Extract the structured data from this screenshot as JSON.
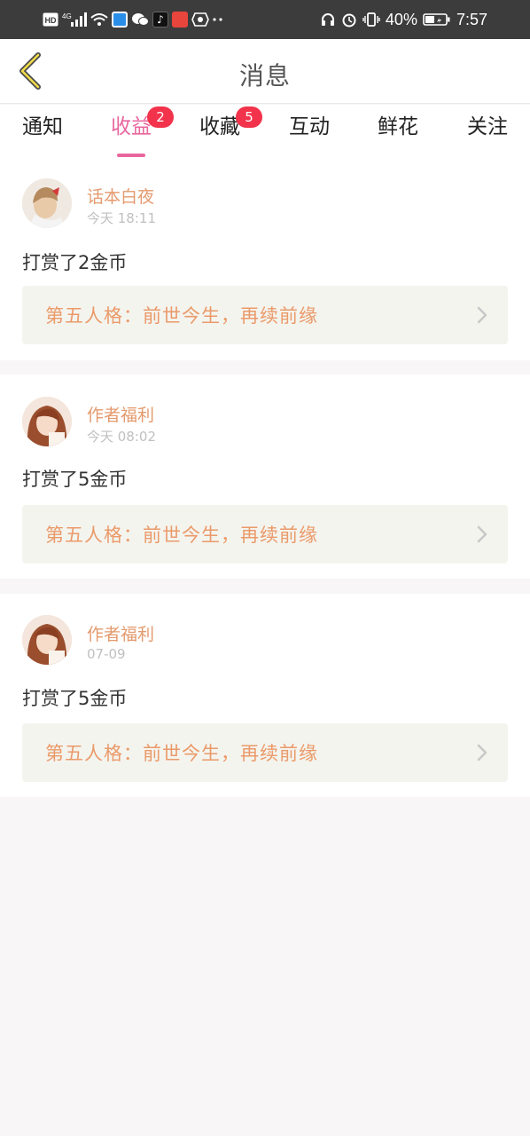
{
  "status_bar": {
    "left_icons": [
      "hd-icon",
      "signal-4g-icon",
      "wifi-icon",
      "app-blue-icon",
      "wechat-icon",
      "tiktok-icon",
      "app-red-icon",
      "shield-app-icon",
      "more-dots-icon"
    ],
    "battery_percent": "40%",
    "time": "7:57",
    "hd_label": "HD",
    "net_label": "4G"
  },
  "header": {
    "title": "消息"
  },
  "tabs": [
    {
      "label": "通知",
      "badge": "",
      "active": false
    },
    {
      "label": "收益",
      "badge": "2",
      "active": true
    },
    {
      "label": "收藏",
      "badge": "5",
      "active": false
    },
    {
      "label": "互动",
      "badge": "",
      "active": false
    },
    {
      "label": "鲜花",
      "badge": "",
      "active": false
    },
    {
      "label": "关注",
      "badge": "",
      "active": false
    }
  ],
  "messages": [
    {
      "user": "话本白夜",
      "time": "今天 18:11",
      "action": "打赏了2金币",
      "book": "第五人格：前世今生，再续前缘"
    },
    {
      "user": "作者福利",
      "time": "今天 08:02",
      "action": "打赏了5金币",
      "book": "第五人格：前世今生，再续前缘"
    },
    {
      "user": "作者福利",
      "time": "07-09",
      "action": "打赏了5金币",
      "book": "第五人格：前世今生，再续前缘"
    }
  ],
  "colors": {
    "accent": "#e8679e",
    "badge": "#f2334b",
    "username": "#e49a6e",
    "book_title": "#ea9a6a"
  }
}
